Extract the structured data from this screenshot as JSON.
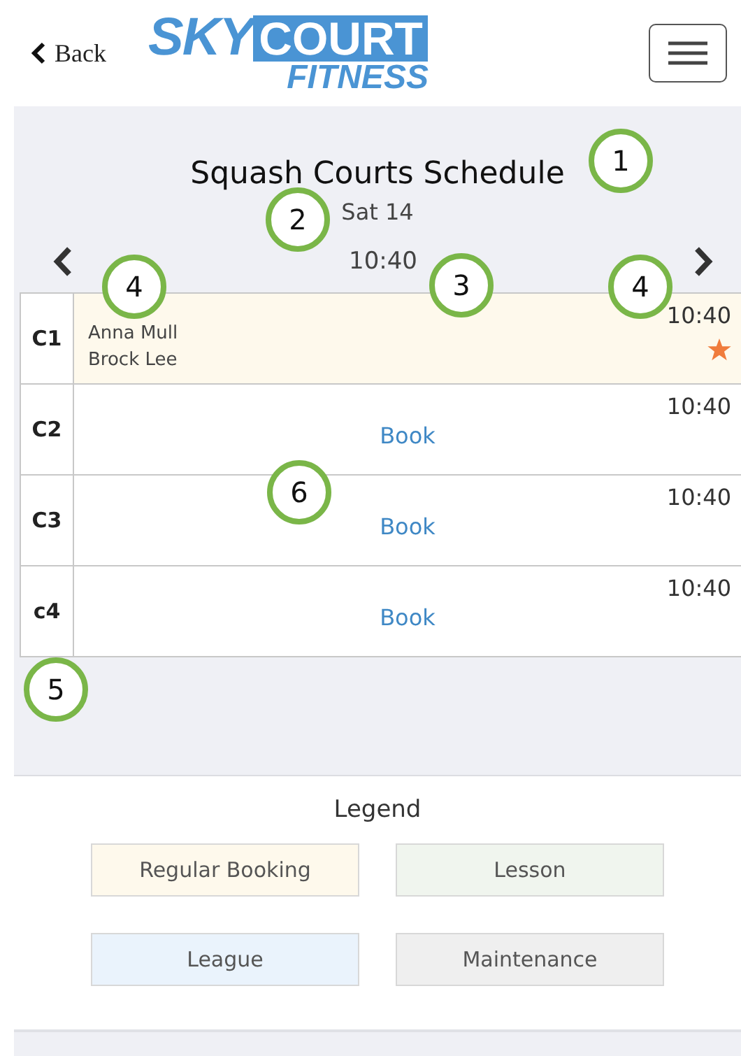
{
  "header": {
    "back": "Back",
    "logo": {
      "word_1": "SKY",
      "word_2": "COURT",
      "word_3": "FITNESS"
    }
  },
  "schedule": {
    "title": "Squash Courts Schedule",
    "date": "Sat 14",
    "time": "10:40",
    "rows": [
      {
        "court": "C1",
        "kind": "booking",
        "time": "10:40",
        "players": [
          "Anna Mull",
          "Brock Lee"
        ],
        "starred": true,
        "color": "#fef9ec"
      },
      {
        "court": "C2",
        "kind": "open",
        "time": "10:40",
        "action": "Book"
      },
      {
        "court": "C3",
        "kind": "open",
        "time": "10:40",
        "action": "Book"
      },
      {
        "court": "c4",
        "kind": "open",
        "time": "10:40",
        "action": "Book"
      }
    ]
  },
  "legend": {
    "title": "Legend",
    "items": [
      {
        "label": "Regular Booking",
        "color": "#fef9ec"
      },
      {
        "label": "Lesson",
        "color": "#f0f5ee"
      },
      {
        "label": "League",
        "color": "#eaf3fc"
      },
      {
        "label": "Maintenance",
        "color": "#efefef"
      }
    ]
  },
  "callouts": [
    "1",
    "2",
    "4",
    "3",
    "4",
    "6",
    "5"
  ]
}
